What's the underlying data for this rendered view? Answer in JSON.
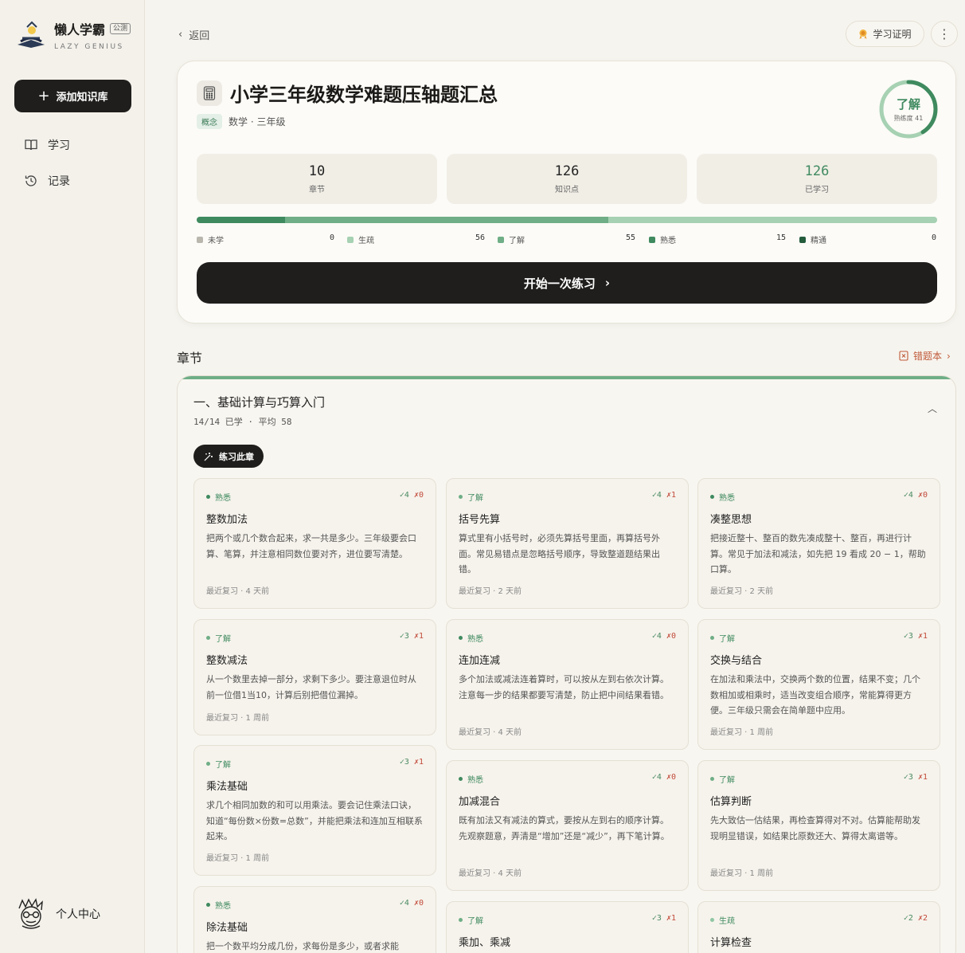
{
  "brand": {
    "name": "懒人学霸",
    "beta": "公测",
    "subtitle": "LAZY GENIUS"
  },
  "sidebar": {
    "add_button": "添加知识库",
    "items": [
      {
        "label": "学习"
      },
      {
        "label": "记录"
      }
    ],
    "profile": "个人中心"
  },
  "header": {
    "back": "返回",
    "certificate": "学习证明",
    "more": "⋮"
  },
  "overview": {
    "title": "小学三年级数学难题压轴题汇总",
    "tag": "概念",
    "subject": "数学 · 三年级",
    "mastery": {
      "level": "了解",
      "proficiency_label": "熟练度 41",
      "proficiency": 41
    },
    "stats": [
      {
        "value": "10",
        "label": "章节"
      },
      {
        "value": "126",
        "label": "知识点"
      },
      {
        "value": "126",
        "label": "已学习"
      }
    ],
    "legend": [
      {
        "label": "未学",
        "value": "0",
        "color": "#b9b6ad"
      },
      {
        "label": "生疏",
        "value": "56",
        "color": "#a6d1b2"
      },
      {
        "label": "了解",
        "value": "55",
        "color": "#6fae86"
      },
      {
        "label": "熟悉",
        "value": "15",
        "color": "#3f8a5f"
      },
      {
        "label": "精通",
        "value": "0",
        "color": "#245c3c"
      }
    ],
    "start_button": "开始一次练习"
  },
  "section": {
    "title": "章节",
    "wrongbook": "错题本"
  },
  "chapter": {
    "title": "一、基础计算与巧算入门",
    "meta": "14/14 已学 · 平均 58",
    "practice_button": "练习此章",
    "recent_prefix": "最近复习",
    "points": [
      {
        "level": "熟悉",
        "ok": "✓4",
        "err": "✗0",
        "name": "整数加法",
        "desc": "把两个或几个数合起来，求一共是多少。三年级要会口算、笔算，并注意相同数位要对齐，进位要写清楚。",
        "recent": "最近复习 · 4 天前"
      },
      {
        "level": "了解",
        "ok": "✓4",
        "err": "✗1",
        "name": "括号先算",
        "desc": "算式里有小括号时，必须先算括号里面，再算括号外面。常见易错点是忽略括号顺序，导致整道题结果出错。",
        "recent": "最近复习 · 2 天前"
      },
      {
        "level": "熟悉",
        "ok": "✓4",
        "err": "✗0",
        "name": "凑整思想",
        "desc": "把接近整十、整百的数先凑成整十、整百，再进行计算。常见于加法和减法，如先把 19 看成 20 − 1，帮助口算。",
        "recent": "最近复习 · 2 天前"
      },
      {
        "level": "了解",
        "ok": "✓3",
        "err": "✗1",
        "name": "整数减法",
        "desc": "从一个数里去掉一部分，求剩下多少。要注意退位时从前一位借1当10，计算后别把借位漏掉。",
        "recent": "最近复习 · 1 周前"
      },
      {
        "level": "熟悉",
        "ok": "✓4",
        "err": "✗0",
        "name": "连加连减",
        "desc": "多个加法或减法连着算时，可以按从左到右依次计算。注意每一步的结果都要写清楚，防止把中间结果看错。",
        "recent": "最近复习 · 4 天前"
      },
      {
        "level": "了解",
        "ok": "✓3",
        "err": "✗1",
        "name": "交换与结合",
        "desc": "在加法和乘法中，交换两个数的位置，结果不变；几个数相加或相乘时，适当改变组合顺序，常能算得更方便。三年级只需会在简单题中应用。",
        "recent": "最近复习 · 1 周前"
      },
      {
        "level": "了解",
        "ok": "✓3",
        "err": "✗1",
        "name": "乘法基础",
        "desc": "求几个相同加数的和可以用乘法。要会记住乘法口诀，知道“每份数×份数=总数”，并能把乘法和连加互相联系起来。",
        "recent": "最近复习 · 1 周前"
      },
      {
        "level": "熟悉",
        "ok": "✓4",
        "err": "✗0",
        "name": "加减混合",
        "desc": "既有加法又有减法的算式，要按从左到右的顺序计算。先观察题意，弄清是“增加”还是“减少”，再下笔计算。",
        "recent": "最近复习 · 4 天前"
      },
      {
        "level": "了解",
        "ok": "✓3",
        "err": "✗1",
        "name": "估算判断",
        "desc": "先大致估一估结果，再检查算得对不对。估算能帮助发现明显错误，如结果比原数还大、算得太离谱等。",
        "recent": "最近复习 · 1 周前"
      },
      {
        "level": "熟悉",
        "ok": "✓4",
        "err": "✗0",
        "name": "除法基础",
        "desc": "把一个数平均分成几份，求每份是多少，或者求能",
        "recent": ""
      },
      {
        "level": "了解",
        "ok": "✓3",
        "err": "✗1",
        "name": "乘加、乘减",
        "desc": "",
        "recent": ""
      },
      {
        "level": "生疏",
        "ok": "✓2",
        "err": "✗2",
        "name": "计算检查",
        "desc": "",
        "recent": ""
      }
    ]
  },
  "colors": {
    "dot_熟悉": "#3f8a5f",
    "dot_了解": "#6fae86",
    "dot_生疏": "#8fc7a2"
  }
}
